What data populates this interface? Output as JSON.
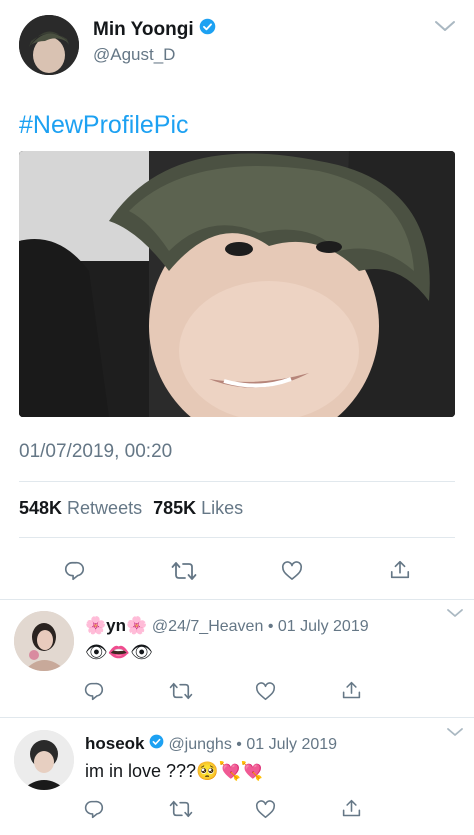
{
  "tweet": {
    "author_name": "Min Yoongi",
    "author_handle": "@Agust_D",
    "text": "#NewProfilePic",
    "timestamp": "01/07/2019, 00:20",
    "retweets_count": "548K",
    "retweets_label": "Retweets",
    "likes_count": "785K",
    "likes_label": "Likes"
  },
  "replies": [
    {
      "name_prefix": "🌸",
      "name": "yn",
      "name_suffix": "🌸",
      "handle": "@24/7_Heaven",
      "separator": "•",
      "date": "01 July 2019",
      "text": "👁👄👁"
    },
    {
      "name": "hoseok",
      "handle": "@junghs",
      "separator": "•",
      "date": "01 July 2019",
      "text": "im in love ???🥺💘💘"
    }
  ],
  "icons": {
    "reply": "reply-icon",
    "retweet": "retweet-icon",
    "like": "heart-icon",
    "share": "share-icon",
    "more": "chevron-down-icon",
    "verified": "verified-badge-icon"
  },
  "colors": {
    "accent": "#1da1f2",
    "muted": "#657786",
    "divider": "#e1e8ed"
  }
}
